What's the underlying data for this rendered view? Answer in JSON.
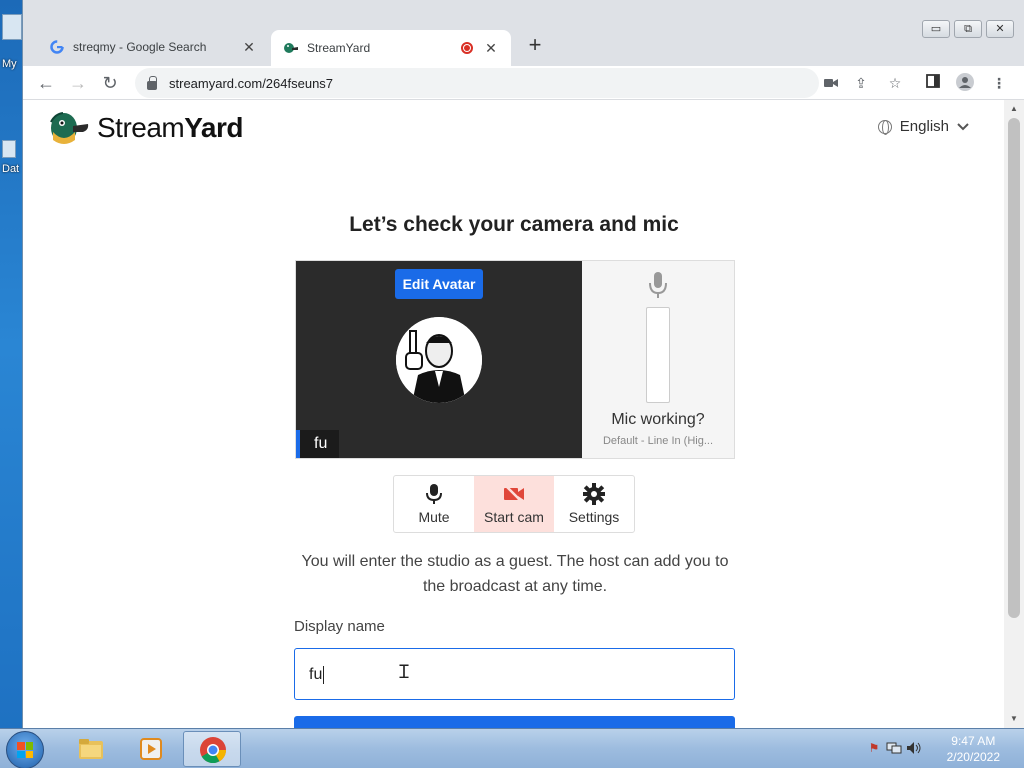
{
  "desktop": {
    "icon_labels": [
      "My",
      "Dat"
    ]
  },
  "browser": {
    "tabs": [
      {
        "title": "streqmy - Google Search",
        "favicon": "google-icon",
        "active": false
      },
      {
        "title": "StreamYard",
        "favicon": "streamyard-icon",
        "active": true,
        "recording": true
      }
    ],
    "new_tab": "+",
    "url": "streamyard.com/264fseuns7",
    "window_controls": [
      "▭",
      "⧉",
      "✕"
    ]
  },
  "page": {
    "logo_stream": "Stream",
    "logo_yard": "Yard",
    "language": "English",
    "heading": "Let’s check your camera and mic",
    "edit_avatar": "Edit Avatar",
    "name_tag": "fu",
    "mic_working": "Mic working?",
    "mic_device": "Default - Line In (Hig...",
    "controls": {
      "mute": "Mute",
      "start_cam": "Start cam",
      "settings": "Settings"
    },
    "guest_text": "You will enter the studio as a guest. The host can add you to the broadcast at any time.",
    "display_name_label": "Display name",
    "display_name_value": "fu"
  },
  "taskbar": {
    "time": "9:47 AM",
    "date": "2/20/2022"
  },
  "colors": {
    "accent": "#1a6be8",
    "cam_off_bg": "#fde0dc",
    "cam_off_icon": "#e0473a"
  }
}
